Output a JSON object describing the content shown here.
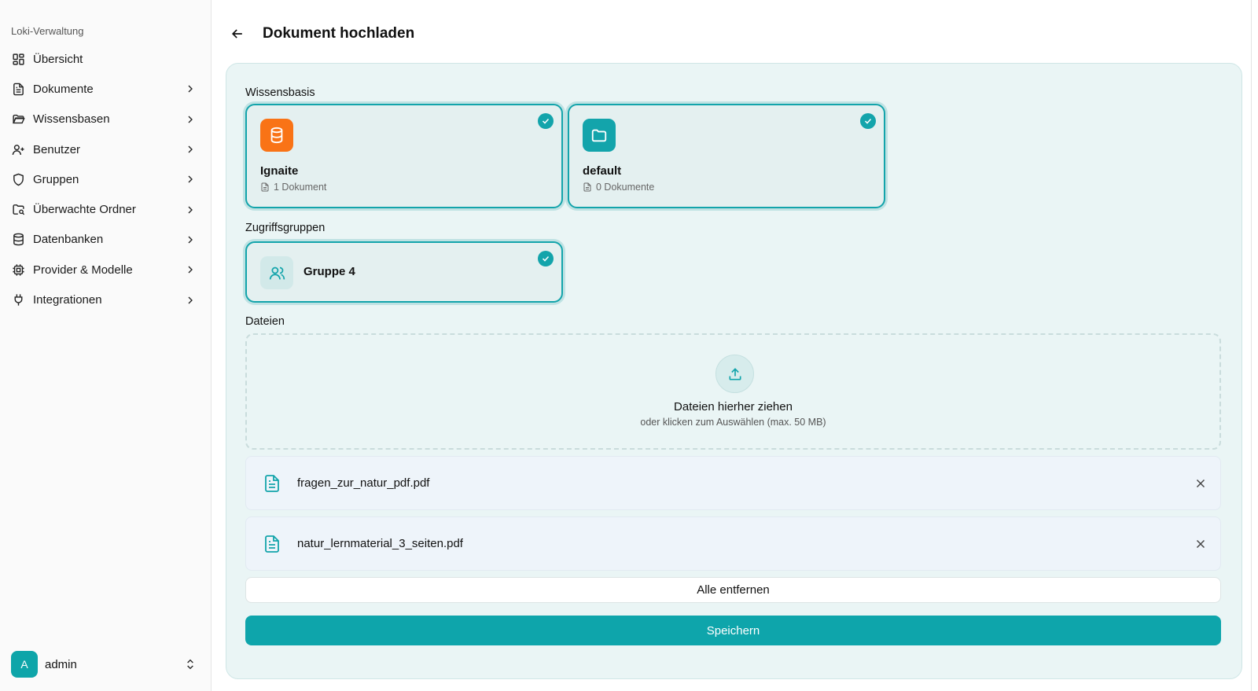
{
  "sidebar": {
    "section_title": "Loki-Verwaltung",
    "items": [
      {
        "label": "Übersicht",
        "icon": "dashboard-grid-icon",
        "has_chevron": false
      },
      {
        "label": "Dokumente",
        "icon": "document-icon",
        "has_chevron": true
      },
      {
        "label": "Wissensbasen",
        "icon": "folder-open-icon",
        "has_chevron": true
      },
      {
        "label": "Benutzer",
        "icon": "user-plus-icon",
        "has_chevron": true
      },
      {
        "label": "Gruppen",
        "icon": "shield-icon",
        "has_chevron": true
      },
      {
        "label": "Überwachte Ordner",
        "icon": "folder-search-icon",
        "has_chevron": true
      },
      {
        "label": "Datenbanken",
        "icon": "database-icon",
        "has_chevron": true
      },
      {
        "label": "Provider & Modelle",
        "icon": "cpu-chip-icon",
        "has_chevron": true
      },
      {
        "label": "Integrationen",
        "icon": "plug-icon",
        "has_chevron": true
      }
    ],
    "user": {
      "initial": "A",
      "name": "admin"
    }
  },
  "header": {
    "title": "Dokument hochladen"
  },
  "form": {
    "knowledge_base_label": "Wissensbasis",
    "knowledge_bases": [
      {
        "name": "Ignaite",
        "count": "1 Dokument",
        "icon": "database-icon",
        "color": "#f97316",
        "selected": true
      },
      {
        "name": "default",
        "count": "0 Dokumente",
        "icon": "folder-icon",
        "color": "#13a4ab",
        "selected": true
      }
    ],
    "access_groups_label": "Zugriffsgruppen",
    "groups": [
      {
        "name": "Gruppe 4",
        "icon": "users-icon",
        "selected": true
      }
    ],
    "files_label": "Dateien",
    "dropzone": {
      "title": "Dateien hierher ziehen",
      "subtitle": "oder klicken zum Auswählen (max. 50 MB)"
    },
    "files": [
      {
        "name": "fragen_zur_natur_pdf.pdf"
      },
      {
        "name": "natur_lernmaterial_3_seiten.pdf"
      }
    ],
    "remove_all_label": "Alle entfernen",
    "save_label": "Speichern"
  },
  "colors": {
    "accent": "#0ea5ab",
    "orange": "#f97316",
    "card_bg": "#eaf5f5"
  }
}
